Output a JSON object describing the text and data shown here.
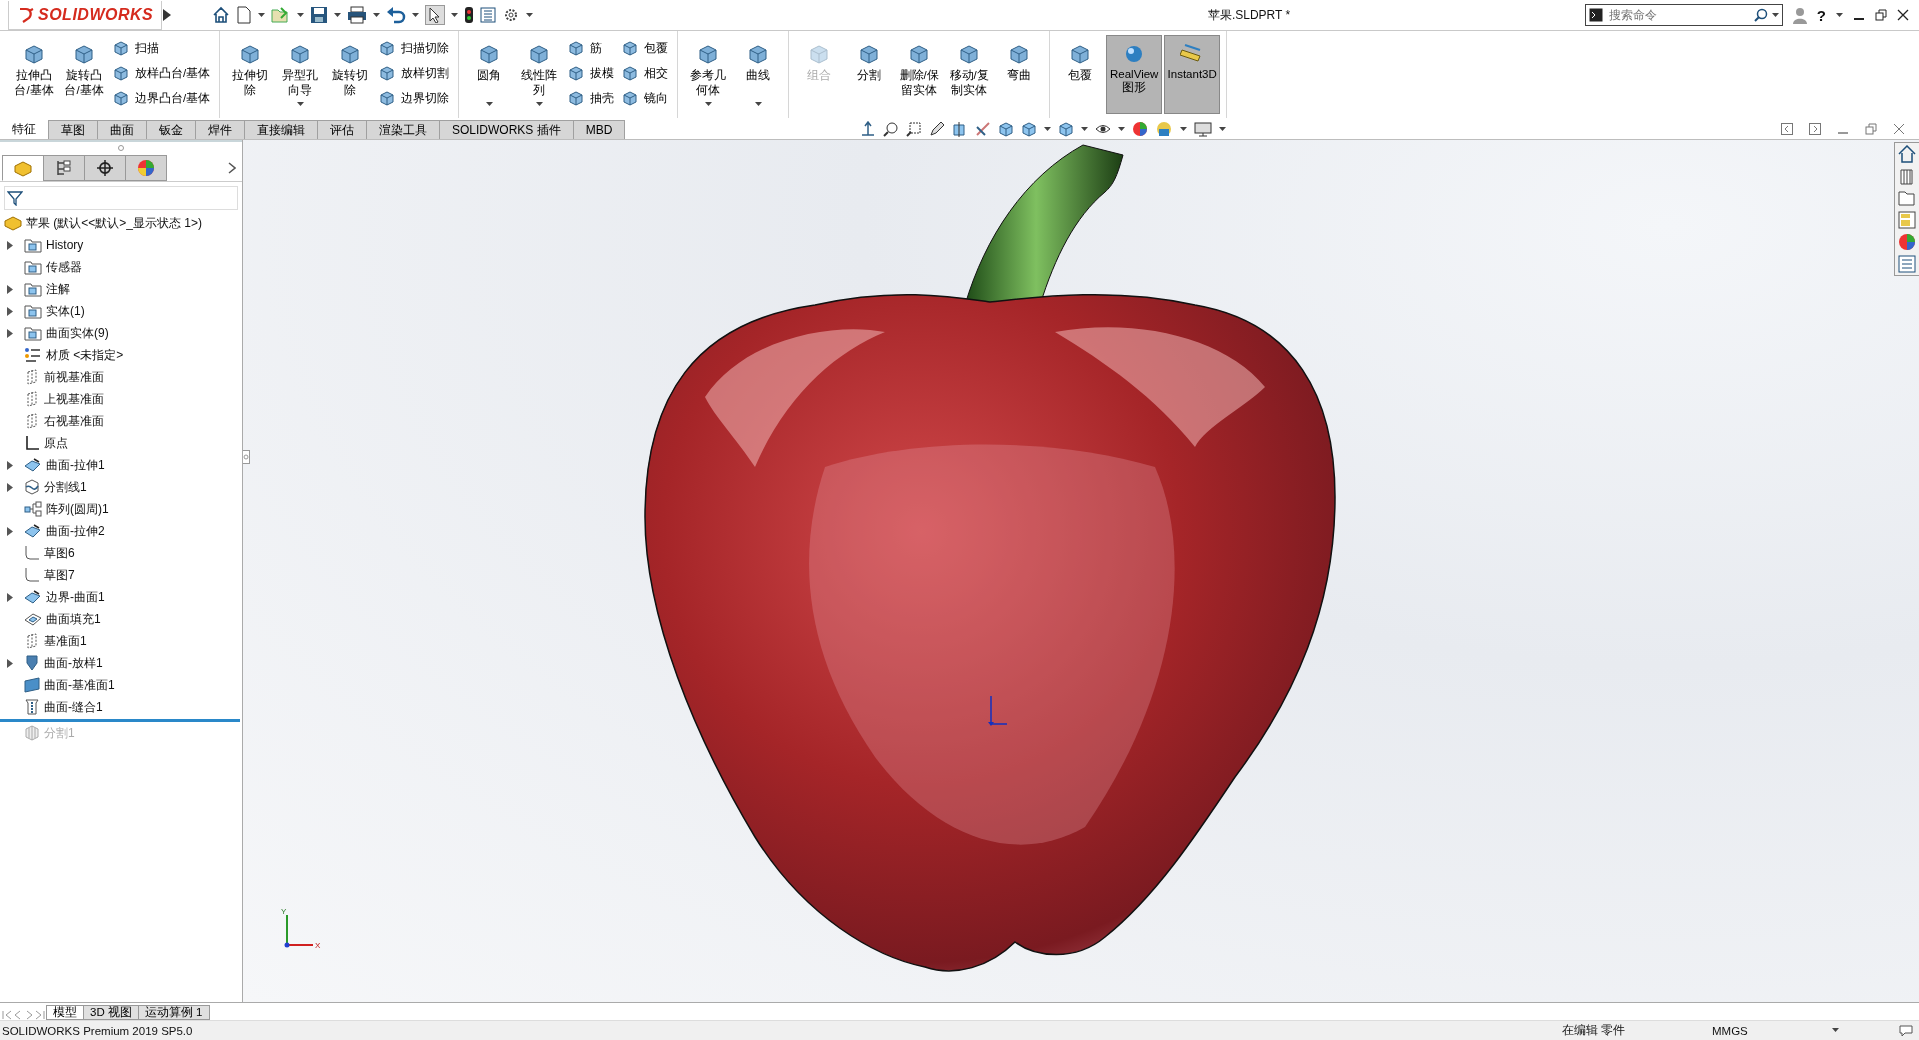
{
  "title_bar": {
    "logo": "SOLIDWORKS",
    "document_title": "苹果.SLDPRT *",
    "search": {
      "placeholder": "搜索命令"
    },
    "help": "?"
  },
  "ribbon": {
    "groups": [
      {
        "columns": [
          {
            "kind": "large",
            "label": "拉伸凸台/基体",
            "disabled": false,
            "pressed": false,
            "dropdown": false
          },
          {
            "kind": "large",
            "label": "旋转凸台/基体",
            "disabled": false,
            "pressed": false,
            "dropdown": false
          },
          {
            "kind": "stack",
            "items": [
              {
                "label": "扫描"
              },
              {
                "label": "放样凸台/基体"
              },
              {
                "label": "边界凸台/基体"
              }
            ]
          }
        ]
      },
      {
        "columns": [
          {
            "kind": "large",
            "label": "拉伸切除",
            "disabled": false,
            "pressed": false,
            "dropdown": false
          },
          {
            "kind": "large",
            "label": "异型孔向导",
            "disabled": false,
            "pressed": false,
            "dropdown": true
          },
          {
            "kind": "large",
            "label": "旋转切除",
            "disabled": false,
            "pressed": false,
            "dropdown": false
          },
          {
            "kind": "stack",
            "items": [
              {
                "label": "扫描切除"
              },
              {
                "label": "放样切割"
              },
              {
                "label": "边界切除"
              }
            ]
          }
        ]
      },
      {
        "columns": [
          {
            "kind": "large",
            "label": "圆角",
            "disabled": false,
            "pressed": false,
            "dropdown": true
          },
          {
            "kind": "large",
            "label": "线性阵列",
            "disabled": false,
            "pressed": false,
            "dropdown": true
          },
          {
            "kind": "stack",
            "items": [
              {
                "label": "筋"
              },
              {
                "label": "拔模"
              },
              {
                "label": "抽壳"
              }
            ]
          },
          {
            "kind": "stack",
            "items": [
              {
                "label": "包覆"
              },
              {
                "label": "相交"
              },
              {
                "label": "镜向"
              }
            ]
          }
        ]
      },
      {
        "columns": [
          {
            "kind": "large",
            "label": "参考几何体",
            "disabled": false,
            "pressed": false,
            "dropdown": true
          },
          {
            "kind": "large",
            "label": "曲线",
            "disabled": false,
            "pressed": false,
            "dropdown": true
          }
        ]
      },
      {
        "columns": [
          {
            "kind": "large",
            "label": "组合",
            "disabled": true,
            "pressed": false,
            "dropdown": false
          },
          {
            "kind": "large",
            "label": "分割",
            "disabled": false,
            "pressed": false,
            "dropdown": false
          },
          {
            "kind": "large",
            "label": "删除/保留实体",
            "disabled": false,
            "pressed": false,
            "dropdown": false
          },
          {
            "kind": "large",
            "label": "移动/复制实体",
            "disabled": false,
            "pressed": false,
            "dropdown": false
          },
          {
            "kind": "large",
            "label": "弯曲",
            "disabled": false,
            "pressed": false,
            "dropdown": false
          }
        ]
      },
      {
        "columns": [
          {
            "kind": "large",
            "label": "包覆",
            "disabled": false,
            "pressed": false,
            "dropdown": false
          },
          {
            "kind": "large",
            "label": "RealView图形",
            "disabled": false,
            "pressed": true,
            "dropdown": false
          },
          {
            "kind": "large",
            "label": "Instant3D",
            "disabled": false,
            "pressed": true,
            "dropdown": false
          }
        ]
      }
    ]
  },
  "command_tabs": [
    {
      "label": "特征",
      "selected": true
    },
    {
      "label": "草图",
      "selected": false
    },
    {
      "label": "曲面",
      "selected": false
    },
    {
      "label": "钣金",
      "selected": false
    },
    {
      "label": "焊件",
      "selected": false
    },
    {
      "label": "直接编辑",
      "selected": false
    },
    {
      "label": "评估",
      "selected": false
    },
    {
      "label": "渲染工具",
      "selected": false
    },
    {
      "label": "SOLIDWORKS 插件",
      "selected": false
    },
    {
      "label": "MBD",
      "selected": false
    }
  ],
  "feature_manager": {
    "panel_tabs": [
      {
        "selected": true
      },
      {
        "selected": false
      },
      {
        "selected": false
      },
      {
        "selected": false
      }
    ],
    "root": {
      "label": "苹果  (默认<<默认>_显示状态 1>)"
    },
    "items": [
      {
        "label": "History",
        "kind": "folder",
        "expandable": true,
        "dimmed": false
      },
      {
        "label": "传感器",
        "kind": "folder",
        "expandable": false,
        "dimmed": false
      },
      {
        "label": "注解",
        "kind": "folder",
        "expandable": true,
        "dimmed": false
      },
      {
        "label": "实体(1)",
        "kind": "folder",
        "expandable": true,
        "dimmed": false
      },
      {
        "label": "曲面实体(9)",
        "kind": "folder",
        "expandable": true,
        "dimmed": false
      },
      {
        "label": "材质 <未指定>",
        "kind": "material",
        "expandable": false,
        "dimmed": false
      },
      {
        "label": "前视基准面",
        "kind": "plane",
        "expandable": false,
        "dimmed": false
      },
      {
        "label": "上视基准面",
        "kind": "plane",
        "expandable": false,
        "dimmed": false
      },
      {
        "label": "右视基准面",
        "kind": "plane",
        "expandable": false,
        "dimmed": false
      },
      {
        "label": "原点",
        "kind": "origin",
        "expandable": false,
        "dimmed": false
      },
      {
        "label": "曲面-拉伸1",
        "kind": "surface",
        "expandable": true,
        "dimmed": false
      },
      {
        "label": "分割线1",
        "kind": "splitline",
        "expandable": true,
        "dimmed": false
      },
      {
        "label": "阵列(圆周)1",
        "kind": "pattern",
        "expandable": false,
        "dimmed": false
      },
      {
        "label": "曲面-拉伸2",
        "kind": "surface",
        "expandable": true,
        "dimmed": false
      },
      {
        "label": "草图6",
        "kind": "sketch",
        "expandable": false,
        "dimmed": false
      },
      {
        "label": "草图7",
        "kind": "sketch",
        "expandable": false,
        "dimmed": false
      },
      {
        "label": "边界-曲面1",
        "kind": "surface",
        "expandable": true,
        "dimmed": false
      },
      {
        "label": "曲面填充1",
        "kind": "fill",
        "expandable": false,
        "dimmed": false
      },
      {
        "label": "基准面1",
        "kind": "plane",
        "expandable": false,
        "dimmed": false
      },
      {
        "label": "曲面-放样1",
        "kind": "loft",
        "expandable": true,
        "dimmed": false
      },
      {
        "label": "曲面-基准面1",
        "kind": "planar",
        "expandable": false,
        "dimmed": false
      },
      {
        "label": "曲面-缝合1",
        "kind": "stitch",
        "expandable": false,
        "dimmed": false
      },
      {
        "label": "分割1",
        "kind": "split",
        "expandable": false,
        "dimmed": true
      }
    ]
  },
  "viewport": {
    "triad": {
      "y_label": "Y",
      "x_label": "X"
    }
  },
  "bottom_tabs": [
    {
      "label": "模型",
      "selected": true
    },
    {
      "label": "3D 视图",
      "selected": false
    },
    {
      "label": "运动算例 1",
      "selected": false
    }
  ],
  "status_bar": {
    "product": "SOLIDWORKS Premium 2019 SP5.0",
    "mode": "在编辑 零件",
    "units": "MMGS"
  }
}
